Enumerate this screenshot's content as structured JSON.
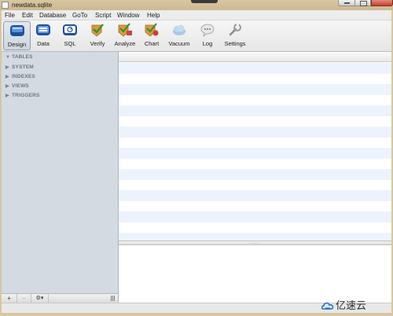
{
  "window": {
    "title": "newdata.sqlite"
  },
  "menu": [
    "File",
    "Edit",
    "Database",
    "GoTo",
    "Script",
    "Window",
    "Help"
  ],
  "toolbar": {
    "selected": "Design",
    "items": [
      {
        "label": "Design",
        "icon": "design-icon"
      },
      {
        "label": "Data",
        "icon": "data-icon"
      },
      {
        "label": "SQL",
        "icon": "sql-icon"
      },
      {
        "label": "Verify",
        "icon": "verify-icon"
      },
      {
        "label": "Analyze",
        "icon": "analyze-icon"
      },
      {
        "label": "Chart",
        "icon": "chart-icon"
      },
      {
        "label": "Vacuum",
        "icon": "vacuum-icon"
      },
      {
        "label": "Log",
        "icon": "log-icon"
      },
      {
        "label": "Settings",
        "icon": "settings-icon"
      }
    ]
  },
  "sidebar": {
    "sections": [
      {
        "label": "TABLES",
        "expanded": true
      },
      {
        "label": "SYSTEM",
        "expanded": false
      },
      {
        "label": "INDEXES",
        "expanded": false
      },
      {
        "label": "VIEWS",
        "expanded": false
      },
      {
        "label": "TRIGGERS",
        "expanded": false
      }
    ],
    "bottom_buttons": {
      "add": "+",
      "remove": "−",
      "gear": "⚙▾"
    }
  },
  "watermark": {
    "text": "亿速云"
  },
  "colors": {
    "sidebar_bg": "#d3dae2",
    "row_alt": "#edf3fd",
    "accent": "#2a62b8"
  }
}
